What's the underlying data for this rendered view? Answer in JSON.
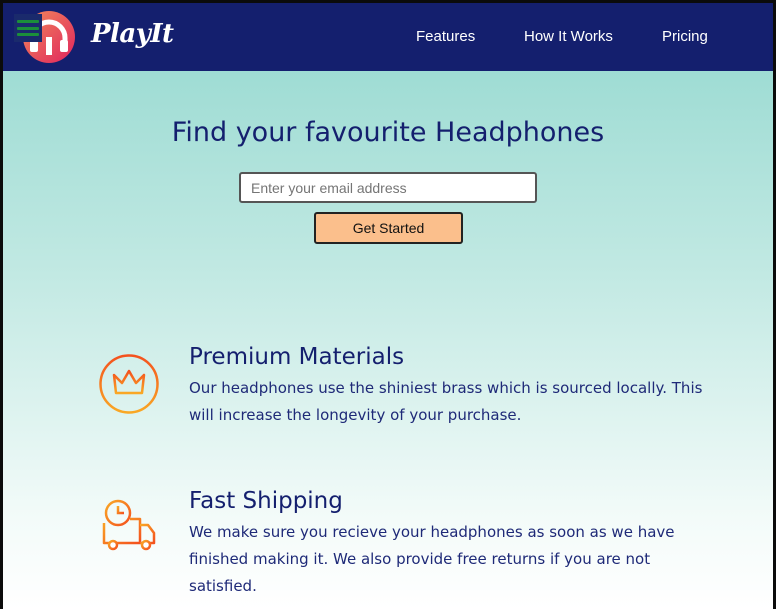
{
  "brand": {
    "name": "PlayIt"
  },
  "nav": {
    "links": [
      {
        "label": "Features"
      },
      {
        "label": "How It Works"
      },
      {
        "label": "Pricing"
      }
    ]
  },
  "hero": {
    "title": "Find your favourite Headphones",
    "email_placeholder": "Enter your email address",
    "email_value": "",
    "cta_label": "Get Started"
  },
  "features": [
    {
      "icon": "crown-icon",
      "title": "Premium Materials",
      "text": "Our headphones use the shiniest brass which is sourced locally. This will increase the longevity of your purchase."
    },
    {
      "icon": "delivery-truck-icon",
      "title": "Fast Shipping",
      "text": "We make sure you recieve your headphones as soon as we have finished making it. We also provide free returns if you are not satisfied."
    }
  ],
  "colors": {
    "navbar": "#141f6e",
    "accent_button": "#fbbf8c",
    "text_dark": "#141f6e",
    "icon_gradient_start": "#f9a825",
    "icon_gradient_end": "#f4511e"
  }
}
